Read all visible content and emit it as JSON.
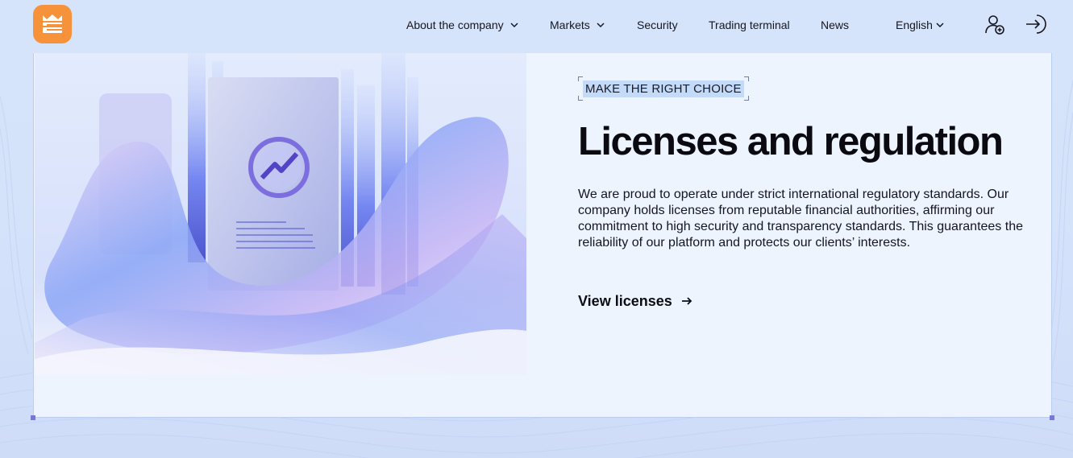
{
  "brand": {
    "accent": "#f6923a",
    "logo_icon": "crown-e-logo"
  },
  "nav": {
    "items": [
      {
        "label": "About the company",
        "has_dropdown": true
      },
      {
        "label": "Markets",
        "has_dropdown": true
      },
      {
        "label": "Security",
        "has_dropdown": false
      },
      {
        "label": "Trading terminal",
        "has_dropdown": false
      },
      {
        "label": "News",
        "has_dropdown": false
      }
    ],
    "language": "English",
    "register_icon": "user-plus-icon",
    "login_icon": "login-arrow-icon"
  },
  "hero": {
    "tag": "MAKE THE RIGHT CHOICE",
    "title": "Licenses and regulation",
    "description": "We are proud to operate under strict international regulatory standards. Our company holds licenses from reputable financial authorities, affirming our commitment to high security and transparency standards. This guarantees the reliability of our platform and protects our clients’ interests.",
    "cta_label": "View licenses",
    "cta_icon": "arrow-right-icon",
    "image": "license-document-illustration"
  }
}
